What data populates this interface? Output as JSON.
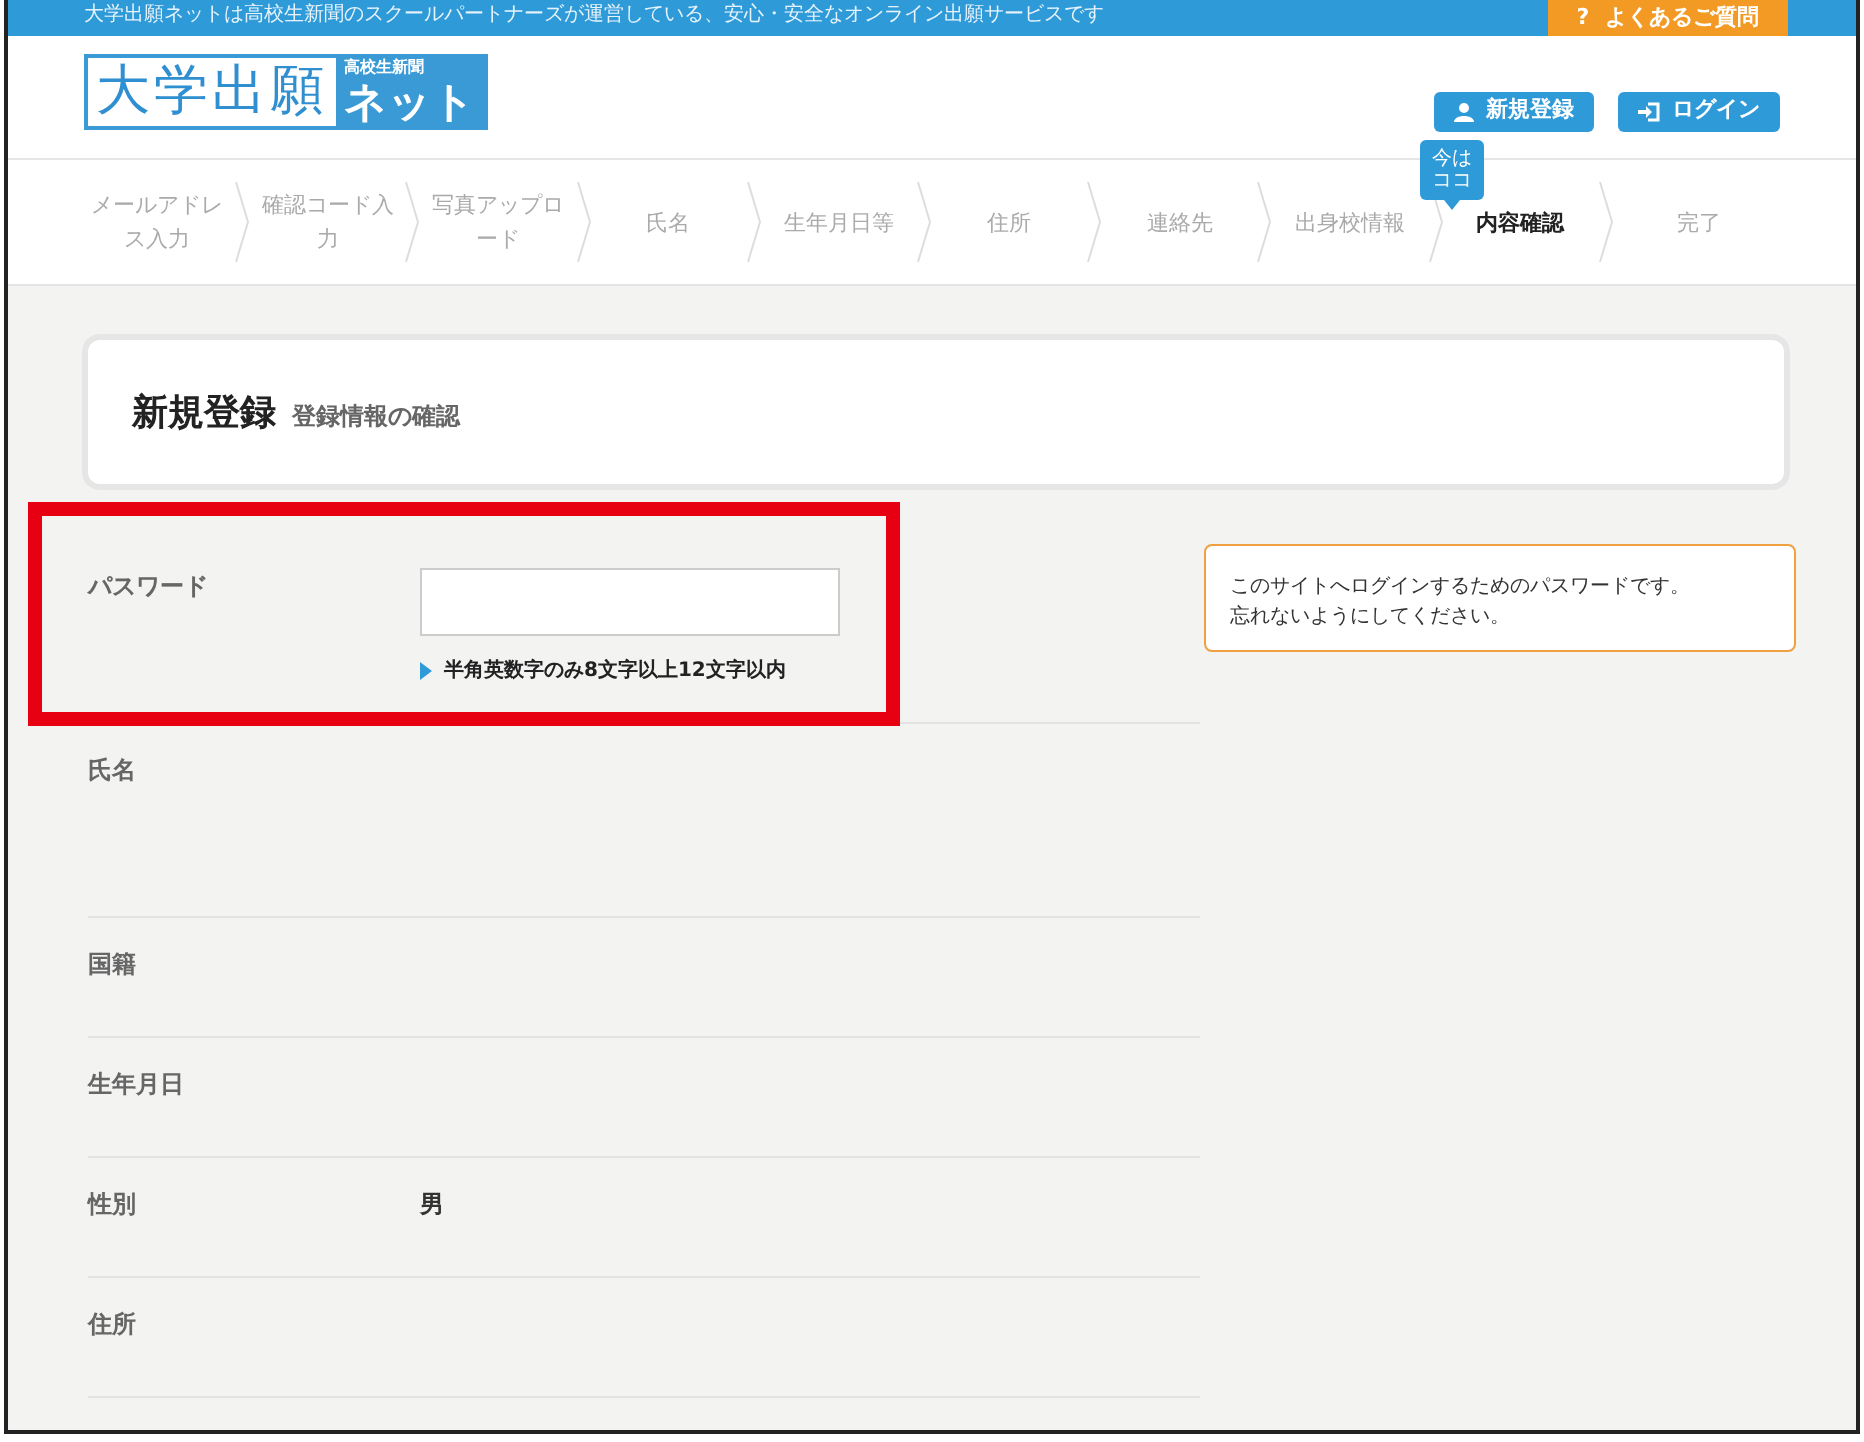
{
  "top_bar": {
    "notice": "大学出願ネットは高校生新聞のスクールパートナーズが運営している、安心・安全なオンライン出願サービスです",
    "help_icon": "?",
    "help_button": "よくあるご質問"
  },
  "header": {
    "logo": {
      "main": "大学出願",
      "sub": "高校生新聞",
      "net": "ネット"
    },
    "buttons": [
      {
        "kind": "register",
        "label": "新規登録"
      },
      {
        "kind": "login",
        "label": "ログイン"
      }
    ],
    "current_marker": "今はココ"
  },
  "steps": [
    {
      "label": "メールアドレス入力",
      "selected": false
    },
    {
      "label": "確認コード入力",
      "selected": false
    },
    {
      "label": "写真アップロード",
      "selected": false
    },
    {
      "label": "氏名",
      "selected": false
    },
    {
      "label": "生年月日等",
      "selected": false
    },
    {
      "label": "住所",
      "selected": false
    },
    {
      "label": "連絡先",
      "selected": false
    },
    {
      "label": "出身校情報",
      "selected": false
    },
    {
      "label": "内容確認",
      "selected": true
    },
    {
      "label": "完了",
      "selected": false
    }
  ],
  "title_card": {
    "title": "新規登録",
    "subtitle": "登録情報の確認"
  },
  "rows": [
    {
      "kind": "password",
      "label": "パスワード",
      "hint": "半角英数字のみ8文字以上12文字以内",
      "tooltip_lines": [
        "このサイトへログインするためのパスワードです。",
        "忘れないようにしてください。"
      ],
      "highlighted": true
    },
    {
      "kind": "name",
      "label": "氏名"
    },
    {
      "kind": "text",
      "label": "国籍"
    },
    {
      "kind": "text",
      "label": "生年月日"
    },
    {
      "kind": "text",
      "label": "性別",
      "value": "男"
    },
    {
      "kind": "text",
      "label": "住所"
    }
  ]
}
